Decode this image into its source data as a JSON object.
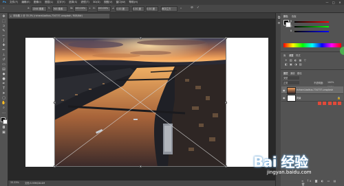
{
  "menubar": {
    "app_logo": "Ps",
    "items": [
      "文件(F)",
      "编辑(E)",
      "图像(I)",
      "图层(L)",
      "文字(Y)",
      "选择(S)",
      "滤镜(T)",
      "3D(D)",
      "视图(V)",
      "窗口(W)",
      "帮助(H)"
    ],
    "window_controls": [
      "—",
      "□",
      "✕"
    ]
  },
  "options": {
    "x_label": "X:",
    "x_value": "1366 像素",
    "y_label": "Y:",
    "y_value": "768 像素",
    "w_label": "W:",
    "w_value": "100.00%",
    "h_label": "H:",
    "h_value": "100.00%",
    "angle_value": "0.00 度",
    "h_skew": "0.00 度",
    "v_skew": "0.00 度",
    "interp": "两次立方"
  },
  "document": {
    "tab_title": "未标题-1 @ 33.3% (richard-balkus-734737-unsplash, RGB/8#)",
    "zoom": "33.33%",
    "doc_size": "文档:5.93M/26.0M"
  },
  "panels": {
    "color_tabs": [
      "颜色",
      "色板"
    ],
    "rgb_labels": [
      "R",
      "G",
      "B"
    ],
    "adjust_tabs": [
      "库",
      "调整",
      "样式"
    ],
    "layer_tabs": [
      "图层",
      "通道",
      "路径"
    ],
    "kind_label": "类型",
    "blend_mode": "正常",
    "opacity_label": "不透明度:",
    "opacity_value": "100%",
    "lock_label": "锁定:",
    "fill_label": "填充:",
    "fill_value": "100%",
    "layers": [
      {
        "name": "richard-balkus-734737-unsplash",
        "selected": true
      },
      {
        "name": "背景",
        "selected": false
      }
    ]
  },
  "watermark": {
    "logo": "Bai 经验",
    "url": "jingyan.baidu.com"
  },
  "colors": {
    "accent": "#4caf50",
    "baidu_blue": "#2f6fd6"
  }
}
